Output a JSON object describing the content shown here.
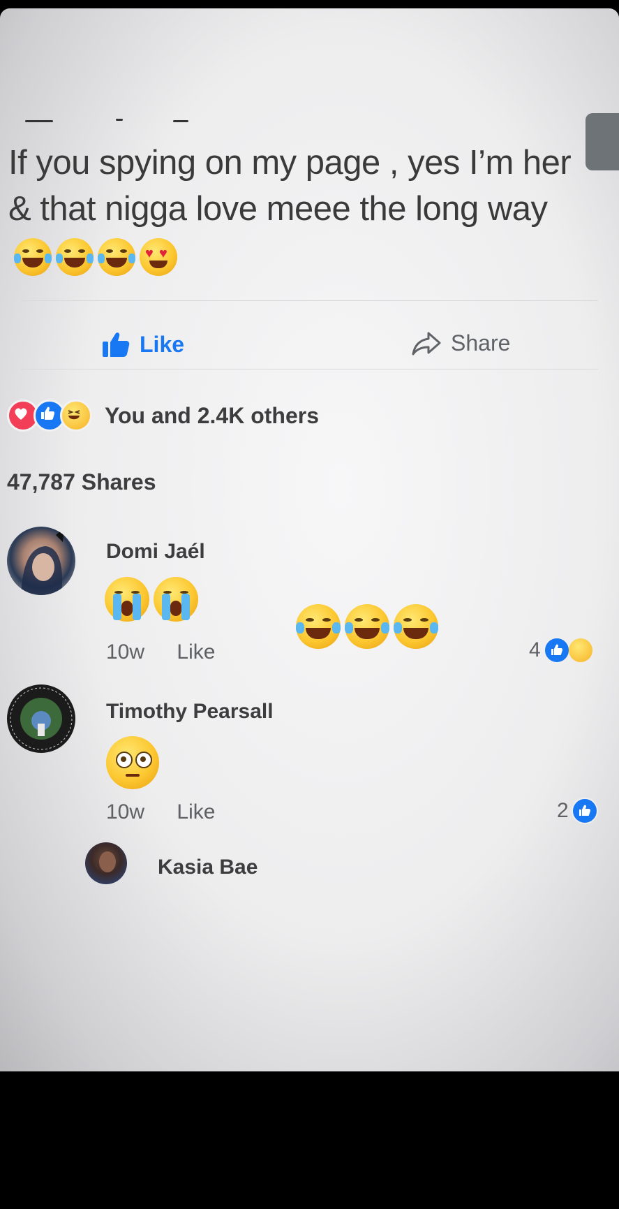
{
  "post": {
    "text": "If you spying on my page , yes I’m her & that nigga love meee the long way",
    "trailing_emojis": [
      "tears-of-joy",
      "tears-of-joy",
      "tears-of-joy",
      "heart-eyes"
    ]
  },
  "actions": {
    "like_label": "Like",
    "share_label": "Share"
  },
  "reactions": {
    "icons": [
      "love-reaction",
      "like-reaction",
      "haha-reaction"
    ],
    "summary": "You and 2.4K others"
  },
  "shares": {
    "label": "47,787 Shares"
  },
  "comments": [
    {
      "name": "Domi Jaél",
      "emojis_line1": [
        "loudly-crying",
        "loudly-crying"
      ],
      "emojis_line2": [
        "tears-of-joy",
        "tears-of-joy",
        "tears-of-joy"
      ],
      "time": "10w",
      "like_label": "Like",
      "reaction_count": "4",
      "reaction_icons": [
        "like-reaction",
        "hug-reaction"
      ]
    },
    {
      "name": "Timothy Pearsall",
      "emojis_line1": [
        "flushed"
      ],
      "time": "10w",
      "like_label": "Like",
      "reaction_count": "2",
      "reaction_icons": [
        "like-reaction"
      ]
    },
    {
      "name": "Kasia Bae"
    }
  ],
  "colors": {
    "brand_blue": "#1877f2",
    "text_dark": "#3d3d3f",
    "love_red": "#f33e58"
  }
}
